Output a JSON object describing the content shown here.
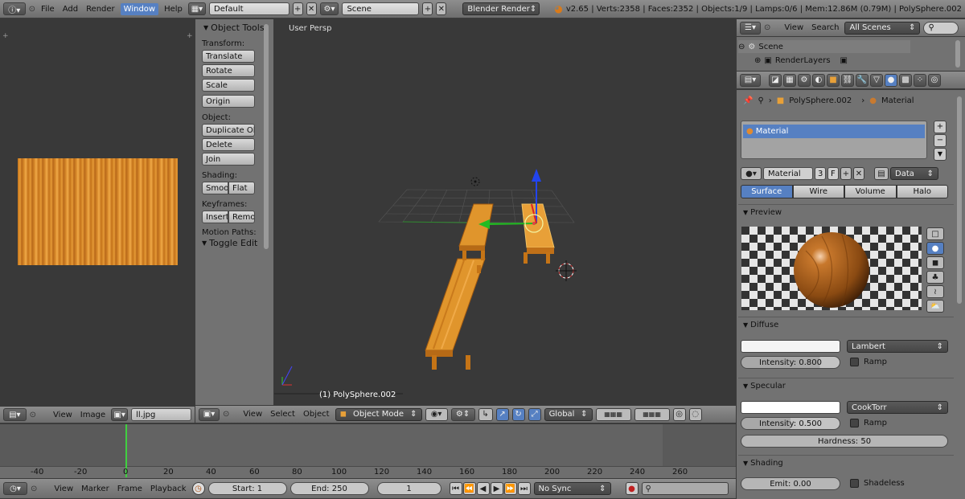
{
  "topbar": {
    "menus": [
      "File",
      "Add",
      "Render",
      "Window",
      "Help"
    ],
    "active_menu": "Window",
    "layout": "Default",
    "scene": "Scene",
    "engine": "Blender Render",
    "stats": "v2.65 | Verts:2358 | Faces:2352 | Objects:1/9 | Lamps:0/6 | Mem:12.86M (0.79M) | PolySphere.002"
  },
  "image_editor": {
    "menus": [
      "View",
      "Image"
    ],
    "image_name": "ll.jpg"
  },
  "tool_shelf": {
    "header": "Object Tools",
    "transform_label": "Transform:",
    "transform": [
      "Translate",
      "Rotate",
      "Scale"
    ],
    "origin": "Origin",
    "object_label": "Object:",
    "object": [
      "Duplicate Obj",
      "Delete",
      "Join"
    ],
    "shading_label": "Shading:",
    "shading": [
      "Smoot",
      "Flat"
    ],
    "keyframes_label": "Keyframes:",
    "keyframes": [
      "Insert",
      "Remo"
    ],
    "motion_paths": "Motion Paths:",
    "toggle_edit": "Toggle Edit"
  },
  "viewport": {
    "label": "User Persp",
    "object_label": "(1) PolySphere.002",
    "menus": [
      "View",
      "Select",
      "Object"
    ],
    "mode": "Object Mode",
    "orientation": "Global"
  },
  "outliner": {
    "menus": [
      "View",
      "Search"
    ],
    "filter": "All Scenes",
    "items": [
      "Scene",
      "RenderLayers"
    ]
  },
  "properties": {
    "breadcrumb_object": "PolySphere.002",
    "breadcrumb_material": "Material",
    "slot_name": "Material",
    "material_name": "Material",
    "users": "3",
    "fake": "F",
    "link": "Data",
    "tabs": [
      "Surface",
      "Wire",
      "Volume",
      "Halo"
    ],
    "active_tab": "Surface",
    "preview_header": "Preview",
    "diffuse_header": "Diffuse",
    "diffuse_shader": "Lambert",
    "diffuse_intensity": "Intensity: 0.800",
    "diffuse_color": "#f4f4f4",
    "ramp": "Ramp",
    "specular_header": "Specular",
    "specular_shader": "CookTorr",
    "specular_intensity": "Intensity: 0.500",
    "hardness": "Hardness: 50",
    "shading_header": "Shading",
    "emit": "Emit: 0.00",
    "shadeless": "Shadeless"
  },
  "timeline": {
    "ticks": [
      "-40",
      "-20",
      "0",
      "20",
      "40",
      "60",
      "80",
      "100",
      "120",
      "140",
      "160",
      "180",
      "200",
      "220",
      "240",
      "260"
    ],
    "menus": [
      "View",
      "Marker",
      "Frame",
      "Playback"
    ],
    "start": "Start: 1",
    "end": "End: 250",
    "current": "1",
    "sync": "No Sync"
  },
  "colors": {
    "accent": "#5680c2",
    "wood": "#d88a1e"
  }
}
